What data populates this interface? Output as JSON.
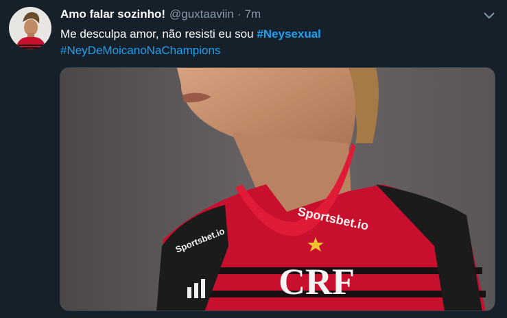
{
  "tweet": {
    "display_name": "Amo falar sozinho!",
    "handle": "@guxtaaviin",
    "separator": "·",
    "timestamp": "7m",
    "text_line1": "Me desculpa amor, não resisti eu sou ",
    "hashtag1": "#Neysexual",
    "hashtag2": "#NeyDeMoicanoNaChampions",
    "menu_icon": "chevron-down-icon",
    "media": {
      "description_icon": "photo",
      "jersey_sponsor_text": "Sportsbet.io",
      "jersey_sponsor_text_chest": "Sportsbet.io",
      "crest_letters": "CRF"
    }
  },
  "colors": {
    "background": "#15202b",
    "text_primary": "#ffffff",
    "text_secondary": "#8899a6",
    "link": "#1da1f2",
    "border": "#38444d"
  }
}
